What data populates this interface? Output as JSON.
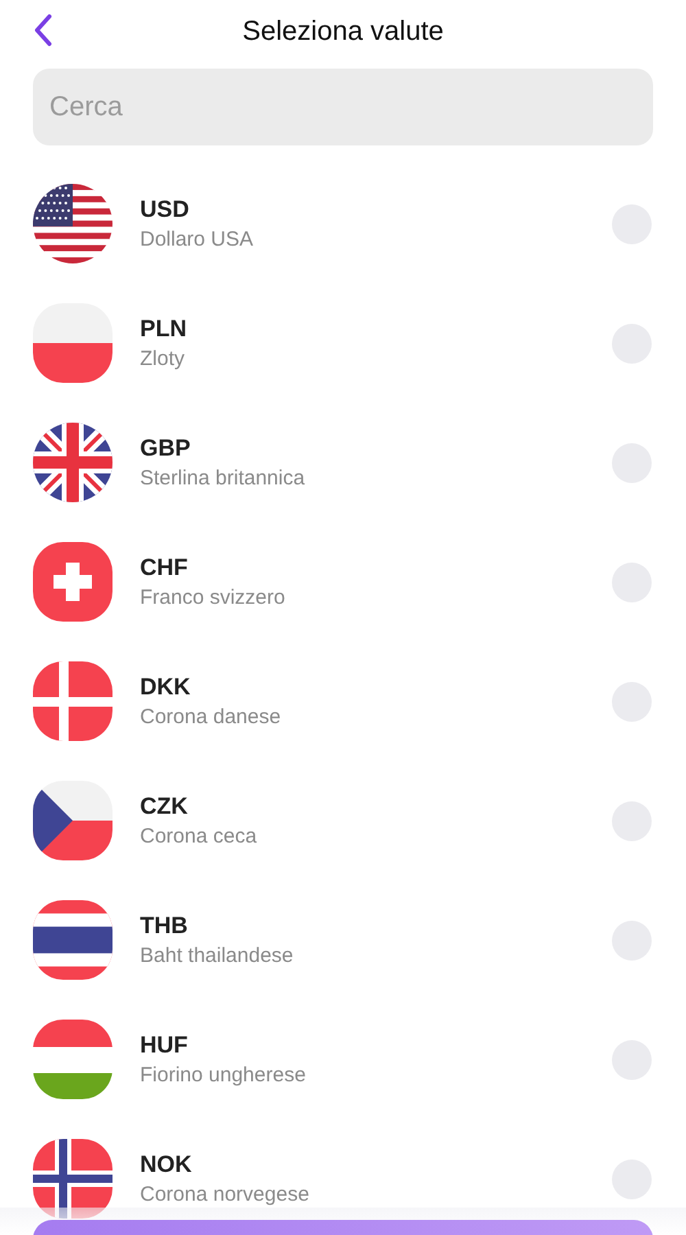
{
  "header": {
    "title": "Seleziona valute"
  },
  "search": {
    "placeholder": "Cerca"
  },
  "currencies": [
    {
      "code": "USD",
      "name": "Dollaro USA",
      "selected": false
    },
    {
      "code": "PLN",
      "name": "Zloty",
      "selected": false
    },
    {
      "code": "GBP",
      "name": "Sterlina britannica",
      "selected": false
    },
    {
      "code": "CHF",
      "name": "Franco svizzero",
      "selected": false
    },
    {
      "code": "DKK",
      "name": "Corona danese",
      "selected": false
    },
    {
      "code": "CZK",
      "name": "Corona ceca",
      "selected": false
    },
    {
      "code": "THB",
      "name": "Baht thailandese",
      "selected": false
    },
    {
      "code": "HUF",
      "name": "Fiorino ungherese",
      "selected": false
    },
    {
      "code": "NOK",
      "name": "Corona norvegese",
      "selected": false
    }
  ]
}
